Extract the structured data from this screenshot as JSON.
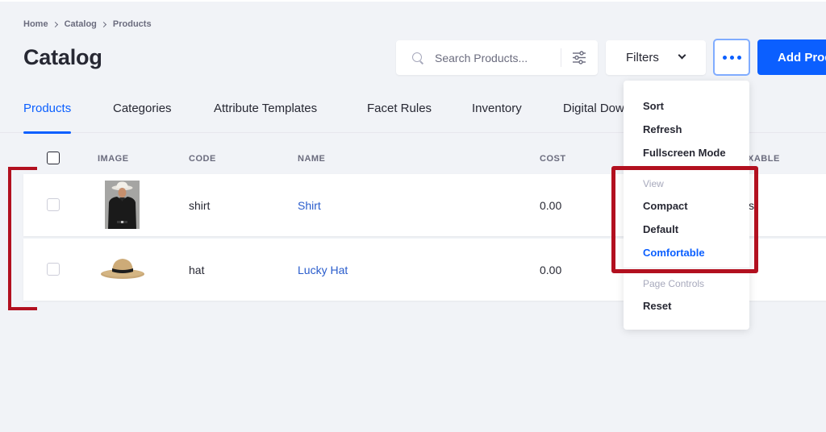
{
  "breadcrumb": [
    "Home",
    "Catalog",
    "Products"
  ],
  "page_title": "Catalog",
  "search": {
    "placeholder": "Search Products..."
  },
  "toolbar": {
    "filters_label": "Filters",
    "add_label": "Add Product"
  },
  "tabs": [
    {
      "label": "Products"
    },
    {
      "label": "Categories"
    },
    {
      "label": "Attribute Templates"
    },
    {
      "label": "Facet Rules"
    },
    {
      "label": "Inventory"
    },
    {
      "label": "Digital Downloads"
    }
  ],
  "table": {
    "columns": [
      "IMAGE",
      "CODE",
      "NAME",
      "COST",
      "XABLE"
    ],
    "rows": [
      {
        "code": "shirt",
        "name": "Shirt",
        "cost": "0.00",
        "extra": "s"
      },
      {
        "code": "hat",
        "name": "Lucky Hat",
        "cost": "0.00",
        "extra": ""
      }
    ]
  },
  "menu": {
    "actions": [
      "Sort",
      "Refresh",
      "Fullscreen Mode"
    ],
    "view_header": "View",
    "view_options": [
      "Compact",
      "Default",
      "Comfortable"
    ],
    "selected_view": "Comfortable",
    "page_controls_header": "Page Controls",
    "page_controls": [
      "Reset"
    ]
  },
  "colors": {
    "primary": "#0b5fff",
    "link": "#295ccc",
    "annotation": "#b2101f",
    "background": "#f1f3f7"
  },
  "icons": [
    "chevron-right-icon",
    "search-icon",
    "sliders-icon",
    "chevron-down-icon",
    "ellipsis-icon",
    "checkbox-icon"
  ]
}
